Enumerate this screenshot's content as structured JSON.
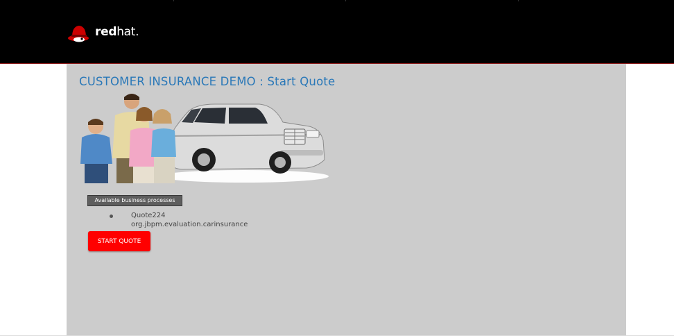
{
  "header": {
    "brand_bold": "red",
    "brand_light": "hat.",
    "logo_icon": "redhat-shadowman-icon",
    "colors": {
      "background": "#000000",
      "accent": "#cc0000"
    }
  },
  "page": {
    "title": "CUSTOMER INSURANCE DEMO : Start Quote",
    "title_color": "#2a78b8",
    "hero_image": "family-with-suv-image"
  },
  "processes": {
    "label": "Available business processes",
    "items": [
      {
        "name": "Quote224",
        "package": "org.jbpm.evaluation.carinsurance"
      }
    ]
  },
  "actions": {
    "start_quote": "START QUOTE",
    "button_color": "#ff0000"
  }
}
